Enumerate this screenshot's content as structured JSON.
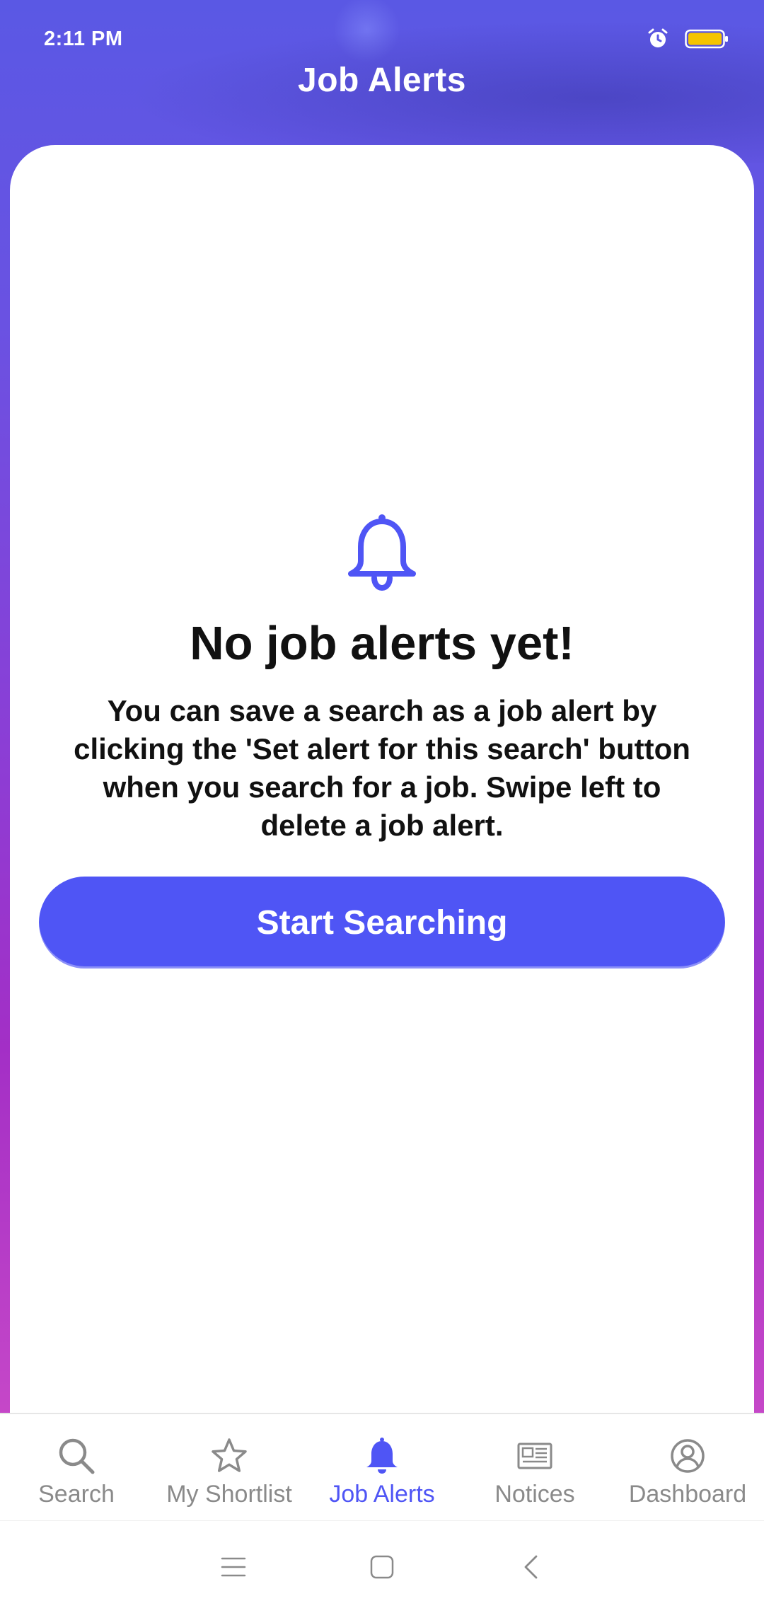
{
  "status_bar": {
    "time": "2:11 PM",
    "icons": [
      "alarm-icon",
      "battery-icon"
    ],
    "battery_color": "#f5c400"
  },
  "header": {
    "title": "Job Alerts"
  },
  "empty_state": {
    "icon": "bell-icon",
    "title": "No job alerts yet!",
    "description": "You can save a search as a job alert by clicking the 'Set alert for this search' button when you search for a job. Swipe left to delete a job alert.",
    "button_label": "Start Searching"
  },
  "bottom_nav": {
    "items": [
      {
        "label": "Search",
        "icon": "search-icon",
        "active": false
      },
      {
        "label": "My Shortlist",
        "icon": "star-icon",
        "active": false
      },
      {
        "label": "Job Alerts",
        "icon": "bell-icon",
        "active": true
      },
      {
        "label": "Notices",
        "icon": "newspaper-icon",
        "active": false
      },
      {
        "label": "Dashboard",
        "icon": "user-circle-icon",
        "active": false
      }
    ]
  },
  "system_nav": {
    "icons": [
      "menu-icon",
      "home-icon",
      "back-icon"
    ]
  },
  "colors": {
    "accent": "#4f55f5",
    "inactive": "#8a8a8a",
    "gradient_top": "#5a58e4",
    "gradient_bottom": "#d058c8"
  }
}
